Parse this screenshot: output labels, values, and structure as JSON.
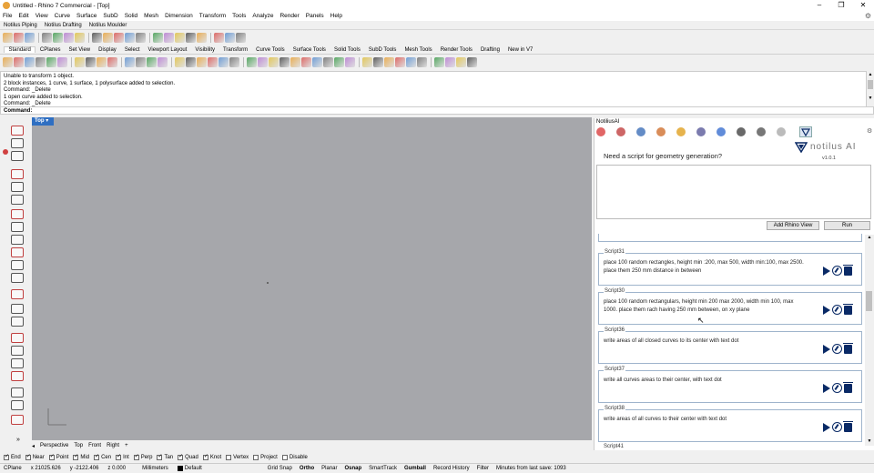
{
  "window": {
    "title": "Untitled - Rhino 7 Commercial - [Top]"
  },
  "menu": [
    "File",
    "Edit",
    "View",
    "Curve",
    "Surface",
    "SubD",
    "Solid",
    "Mesh",
    "Dimension",
    "Transform",
    "Tools",
    "Analyze",
    "Render",
    "Panels",
    "Help"
  ],
  "plugin_tabs": [
    "Notilus Piping",
    "Notilus Drafting",
    "Notilus Moulder"
  ],
  "toolbar_tabs": [
    "Standard",
    "CPlanes",
    "Set View",
    "Display",
    "Select",
    "Viewport Layout",
    "Visibility",
    "Transform",
    "Curve Tools",
    "Surface Tools",
    "Solid Tools",
    "SubD Tools",
    "Mesh Tools",
    "Render Tools",
    "Drafting",
    "New in V7"
  ],
  "command_history": [
    "Unable to transform 1 object.",
    "2 block instances, 1 curve, 1 surface, 1 polysurface added to selection.",
    "Command: _Delete",
    "1 open curve added to selection.",
    "Command: _Delete"
  ],
  "command_prompt": "Command:",
  "viewport": {
    "name": "Top",
    "tabs": [
      "Perspective",
      "Top",
      "Front",
      "Right"
    ]
  },
  "osnaps": [
    {
      "label": "End",
      "on": true
    },
    {
      "label": "Near",
      "on": true
    },
    {
      "label": "Point",
      "on": true
    },
    {
      "label": "Mid",
      "on": true
    },
    {
      "label": "Cen",
      "on": true
    },
    {
      "label": "Int",
      "on": true
    },
    {
      "label": "Perp",
      "on": true
    },
    {
      "label": "Tan",
      "on": true
    },
    {
      "label": "Quad",
      "on": true
    },
    {
      "label": "Knot",
      "on": true
    },
    {
      "label": "Vertex",
      "on": false
    },
    {
      "label": "Project",
      "on": false
    },
    {
      "label": "Disable",
      "on": false
    }
  ],
  "status": {
    "cplane": "CPlane",
    "x": "x 21025.626",
    "y": "y -2122.406",
    "z": "z 0.000",
    "units": "Millimeters",
    "layer": "Default",
    "toggles": [
      "Grid Snap",
      "Ortho",
      "Planar",
      "Osnap",
      "SmartTrack",
      "Gumball",
      "Record History",
      "Filter"
    ],
    "save_info": "Minutes from last save: 1093"
  },
  "panel": {
    "title": "NotiliusAI",
    "question": "Need a script for geometry generation?",
    "logo_text": "notilus AI",
    "version": "v1.0.1",
    "add_view_label": "Add Rhino View",
    "run_label": "Run",
    "scripts": [
      {
        "label": "Script31",
        "text": "place 100 random rectangles, height min :200, max 500, width min:100, max 2500. place them 250 mm distance in between"
      },
      {
        "label": "Script30",
        "text": "place 100 random rectangulars, height min 200 max 2000, width min 100, max 1000. place them rach having 250 mm between, on xy plane"
      },
      {
        "label": "Script36",
        "text": "write areas of all closed curves to its center with text dot"
      },
      {
        "label": "Script37",
        "text": "write all curves areas to their center, with text dot"
      },
      {
        "label": "Script38",
        "text": "write areas of all curves to their center with text dot"
      }
    ],
    "next_script_label": "Script41"
  }
}
